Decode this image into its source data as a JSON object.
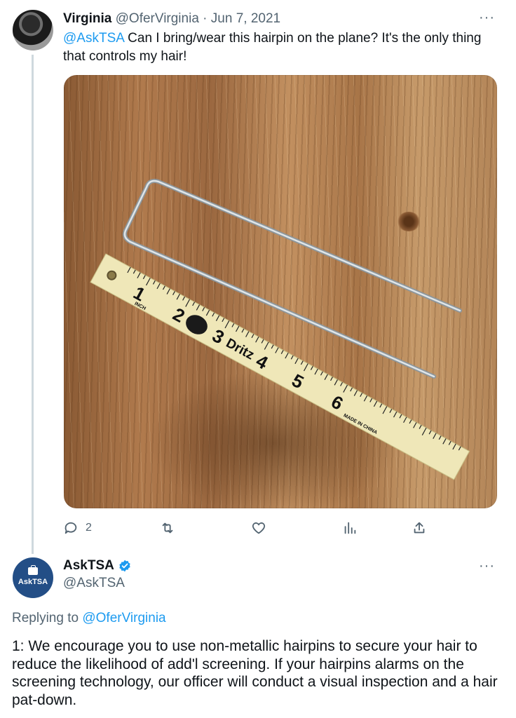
{
  "tweet1": {
    "author_name": "Virginia",
    "author_handle": "@OferVirginia",
    "separator": "·",
    "date": "Jun 7, 2021",
    "mention": "@AskTSA",
    "text": " Can I bring/wear this hairpin on the plane? It's the only thing that controls my hair!",
    "more_label": "···",
    "photo": {
      "tape_numbers": [
        "1",
        "2",
        "3",
        "4",
        "5",
        "6"
      ],
      "tape_text_inch": "INCH",
      "tape_brand": "Dritz",
      "tape_text_origin": "MADE IN CHINA"
    },
    "actions": {
      "reply_count": "2"
    }
  },
  "tweet2": {
    "author_name": "AskTSA",
    "author_handle": "@AskTSA",
    "avatar_label": "AskTSA",
    "more_label": "···",
    "replying_prefix": "Replying to ",
    "replying_handle": "@OferVirginia",
    "text": "1: We encourage you to use non-metallic hairpins to secure your hair to reduce the likelihood of add'l screening. If your hairpins alarms on the screening technology, our officer will conduct a visual inspection and a hair pat-down."
  },
  "colors": {
    "link": "#1d9bf0",
    "muted": "#536471",
    "verified": "#1d9bf0",
    "tsa_blue": "#234e86"
  }
}
